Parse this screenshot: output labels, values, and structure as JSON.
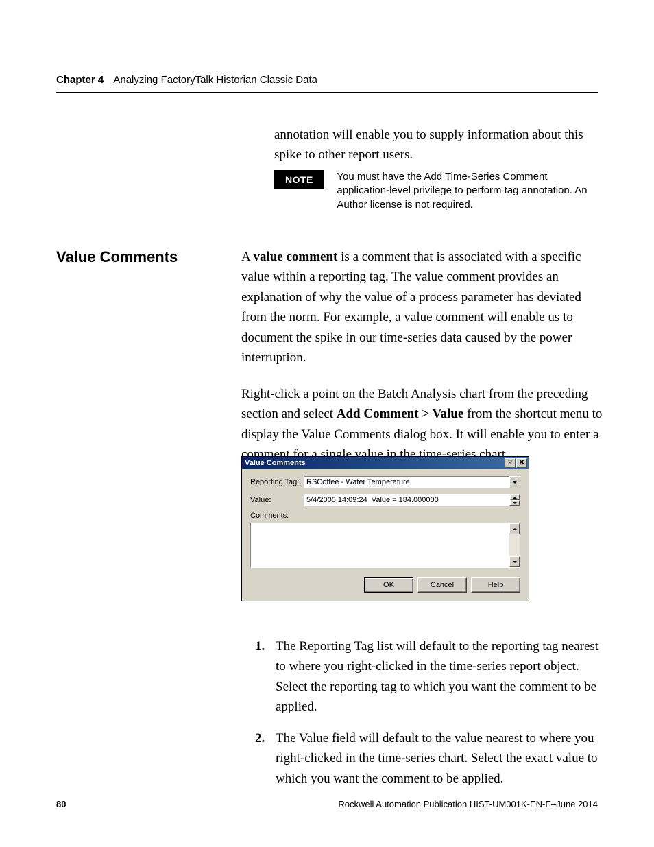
{
  "header": {
    "chapter_label": "Chapter 4",
    "chapter_title": "Analyzing FactoryTalk Historian Classic Data"
  },
  "intro_paragraph": "annotation will enable you to supply information about this spike to other report users.",
  "note": {
    "badge": "NOTE",
    "text": "You must have the Add Time-Series Comment application-level privilege to perform tag annotation. An Author license is not required."
  },
  "section_heading": "Value Comments",
  "para_a_pre": "A ",
  "para_a_bold": "value comment",
  "para_a_post": " is a comment that is associated with a specific value within a reporting tag. The value comment provides an explanation of why the value of a process parameter has deviated from the norm. For example, a value comment will enable us to document the spike in our time-series data caused by the power interruption.",
  "para_b_pre": "Right-click a point on the Batch Analysis chart from the preceding section and select ",
  "para_b_bold": "Add Comment > Value",
  "para_b_post": " from the shortcut menu to display the Value Comments dialog box. It will enable you to enter a comment for a single value in the time-series chart.",
  "dialog": {
    "title": "Value Comments",
    "help_btn": "?",
    "close_btn": "✕",
    "reporting_tag_label": "Reporting Tag:",
    "reporting_tag_value": "RSCoffee - Water Temperature",
    "value_label": "Value:",
    "value_value": "5/4/2005 14:09:24  Value = 184.000000",
    "comments_label": "Comments:",
    "ok_btn": "OK",
    "cancel_btn": "Cancel",
    "help_btn_label": "Help"
  },
  "list": {
    "item1_num": "1.",
    "item1_text": "The Reporting Tag list will default to the reporting tag nearest to where you right-clicked in the time-series report object. Select the reporting tag to which you want the comment to be applied.",
    "item2_num": "2.",
    "item2_text": "The Value field will default to the value nearest to where you right-clicked in the time-series chart. Select the exact value to which you want the comment to be applied."
  },
  "footer": {
    "page_number": "80",
    "publication": "Rockwell Automation Publication HIST-UM001K-EN-E–June 2014"
  }
}
